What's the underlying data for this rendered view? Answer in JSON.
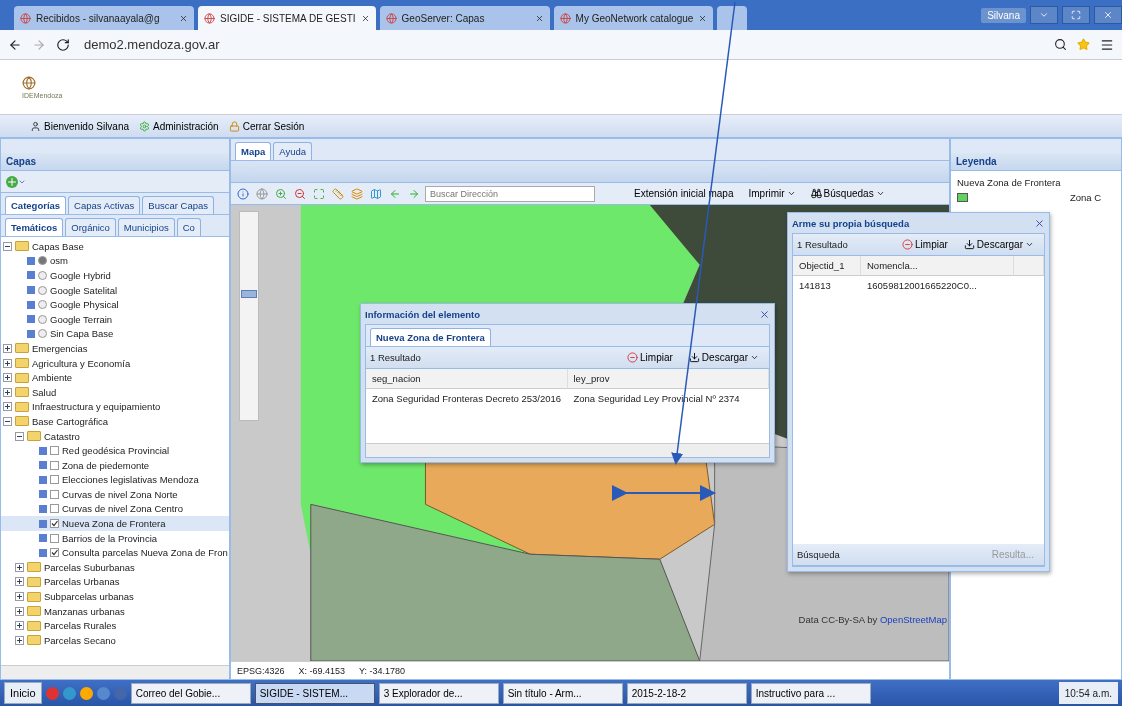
{
  "browser": {
    "tabs": [
      {
        "label": "Recibidos - silvanaayala@g",
        "selected": false
      },
      {
        "label": "SIGIDE - SISTEMA DE GESTI",
        "selected": true
      },
      {
        "label": "GeoServer: Capas",
        "selected": false
      },
      {
        "label": "My GeoNetwork catalogue",
        "selected": false
      }
    ],
    "user": "Silvana",
    "url": "demo2.mendoza.gov.ar"
  },
  "header": {
    "logo_text": "IDEMendoza"
  },
  "user_bar": [
    {
      "label": "Bienvenido Silvana"
    },
    {
      "label": "Administración"
    },
    {
      "label": "Cerrar Sesión"
    }
  ],
  "left_panel": {
    "title": "Capas",
    "tabs": [
      {
        "label": "Categorías",
        "selected": true
      },
      {
        "label": "Capas Activas",
        "selected": false
      },
      {
        "label": "Buscar Capas",
        "selected": false
      }
    ],
    "subtabs": [
      {
        "label": "Temáticos",
        "selected": true
      },
      {
        "label": "Orgánico",
        "selected": false
      },
      {
        "label": "Municipios",
        "selected": false
      },
      {
        "label": "Co",
        "selected": false
      }
    ],
    "tree": [
      {
        "kind": "folder",
        "label": "Capas Base",
        "expanded": true,
        "children": [
          {
            "kind": "radio",
            "label": "osm",
            "on": true
          },
          {
            "kind": "radio",
            "label": "Google Hybrid",
            "on": false
          },
          {
            "kind": "radio",
            "label": "Google Satelital",
            "on": false
          },
          {
            "kind": "radio",
            "label": "Google Physical",
            "on": false
          },
          {
            "kind": "radio",
            "label": "Google Terrain",
            "on": false
          },
          {
            "kind": "radio",
            "label": "Sin Capa Base",
            "on": false
          }
        ]
      },
      {
        "kind": "folder",
        "label": "Emergencias",
        "expanded": false
      },
      {
        "kind": "folder",
        "label": "Agricultura y Economía",
        "expanded": false
      },
      {
        "kind": "folder",
        "label": "Ambiente",
        "expanded": false
      },
      {
        "kind": "folder",
        "label": "Salud",
        "expanded": false
      },
      {
        "kind": "folder",
        "label": "Infraestructura y equipamiento",
        "expanded": false
      },
      {
        "kind": "folder",
        "label": "Base Cartográfica",
        "expanded": true,
        "children": [
          {
            "kind": "folder",
            "label": "Catastro",
            "expanded": true,
            "children": [
              {
                "kind": "check",
                "label": "Red geodésica Provincial",
                "checked": false,
                "selected": false
              },
              {
                "kind": "check",
                "label": "Zona de piedemonte",
                "checked": false,
                "selected": false
              },
              {
                "kind": "check",
                "label": "Elecciones legislativas Mendoza",
                "checked": false,
                "selected": false
              },
              {
                "kind": "check",
                "label": "Curvas de nivel Zona Norte",
                "checked": false,
                "selected": false
              },
              {
                "kind": "check",
                "label": "Curvas de nivel Zona Centro",
                "checked": false,
                "selected": false
              },
              {
                "kind": "check",
                "label": "Nueva Zona de Frontera",
                "checked": true,
                "selected": true
              },
              {
                "kind": "check",
                "label": "Barrios de la Provincia",
                "checked": false,
                "selected": false
              },
              {
                "kind": "check",
                "label": "Consulta parcelas Nueva Zona de Fron",
                "checked": true,
                "selected": false
              }
            ]
          },
          {
            "kind": "folder",
            "label": "Parcelas Suburbanas",
            "expanded": false
          },
          {
            "kind": "folder",
            "label": "Parcelas Urbanas",
            "expanded": false
          },
          {
            "kind": "folder",
            "label": "Subparcelas urbanas",
            "expanded": false
          },
          {
            "kind": "folder",
            "label": "Manzanas urbanas",
            "expanded": false
          },
          {
            "kind": "folder",
            "label": "Parcelas Rurales",
            "expanded": false
          },
          {
            "kind": "folder",
            "label": "Parcelas Secano",
            "expanded": false
          }
        ]
      }
    ]
  },
  "map_panel": {
    "tabs": [
      {
        "label": "Mapa",
        "selected": true
      },
      {
        "label": "Ayuda",
        "selected": false
      }
    ],
    "search": {
      "placeholder": "Buscar Dirección"
    },
    "zoom": {
      "level": 0.6
    },
    "buttons": [
      {
        "label": "Extensión inicial mapa",
        "dropdown": false
      },
      {
        "label": "Imprimir",
        "dropdown": true
      },
      {
        "label": "Búsquedas",
        "dropdown": true
      }
    ],
    "attribution": {
      "text": "Data CC-By-SA by",
      "link": "OpenStreetMap"
    },
    "status": [
      "EPSG:4326",
      "X: -69.4153",
      "Y: -34.1780"
    ]
  },
  "info_window": {
    "title": "Información del elemento",
    "tab": "Nueva Zona de Frontera",
    "count": "1 Resultado",
    "clear": "Limpiar",
    "download": "Descargar",
    "columns": [
      "seg_nacion",
      "ley_prov"
    ],
    "rows": [
      [
        "Zona Seguridad Fronteras Decreto 253/2016",
        "Zona Seguridad Ley Provincial Nº 2374"
      ]
    ]
  },
  "search_window": {
    "title": "Arme su propia búsqueda",
    "count": "1 Resultado",
    "clear": "Limpiar",
    "download": "Descargar",
    "columns": [
      "Objectid_1",
      "Nomencla..."
    ],
    "rows": [
      [
        "141813",
        "16059812001665220C0..."
      ]
    ],
    "footer": "Búsqueda",
    "footer_button": "Resulta..."
  },
  "legend": {
    "title": "Leyenda",
    "layer": "Nueva Zona de Frontera",
    "items": [
      {
        "label": "Zona C",
        "color": "#5fd35f"
      }
    ]
  },
  "taskbar": {
    "start": "Inicio",
    "items": [
      {
        "label": "Correo del Gobie...",
        "selected": false
      },
      {
        "label": "SIGIDE - SISTEM...",
        "selected": true
      },
      {
        "label": "3 Explorador de...",
        "selected": false
      },
      {
        "label": "Sin título - Arm...",
        "selected": false
      },
      {
        "label": "2015-2-18-2",
        "selected": false
      },
      {
        "label": "Instructivo para ...",
        "selected": false
      }
    ],
    "clock": "10:54 a.m."
  }
}
